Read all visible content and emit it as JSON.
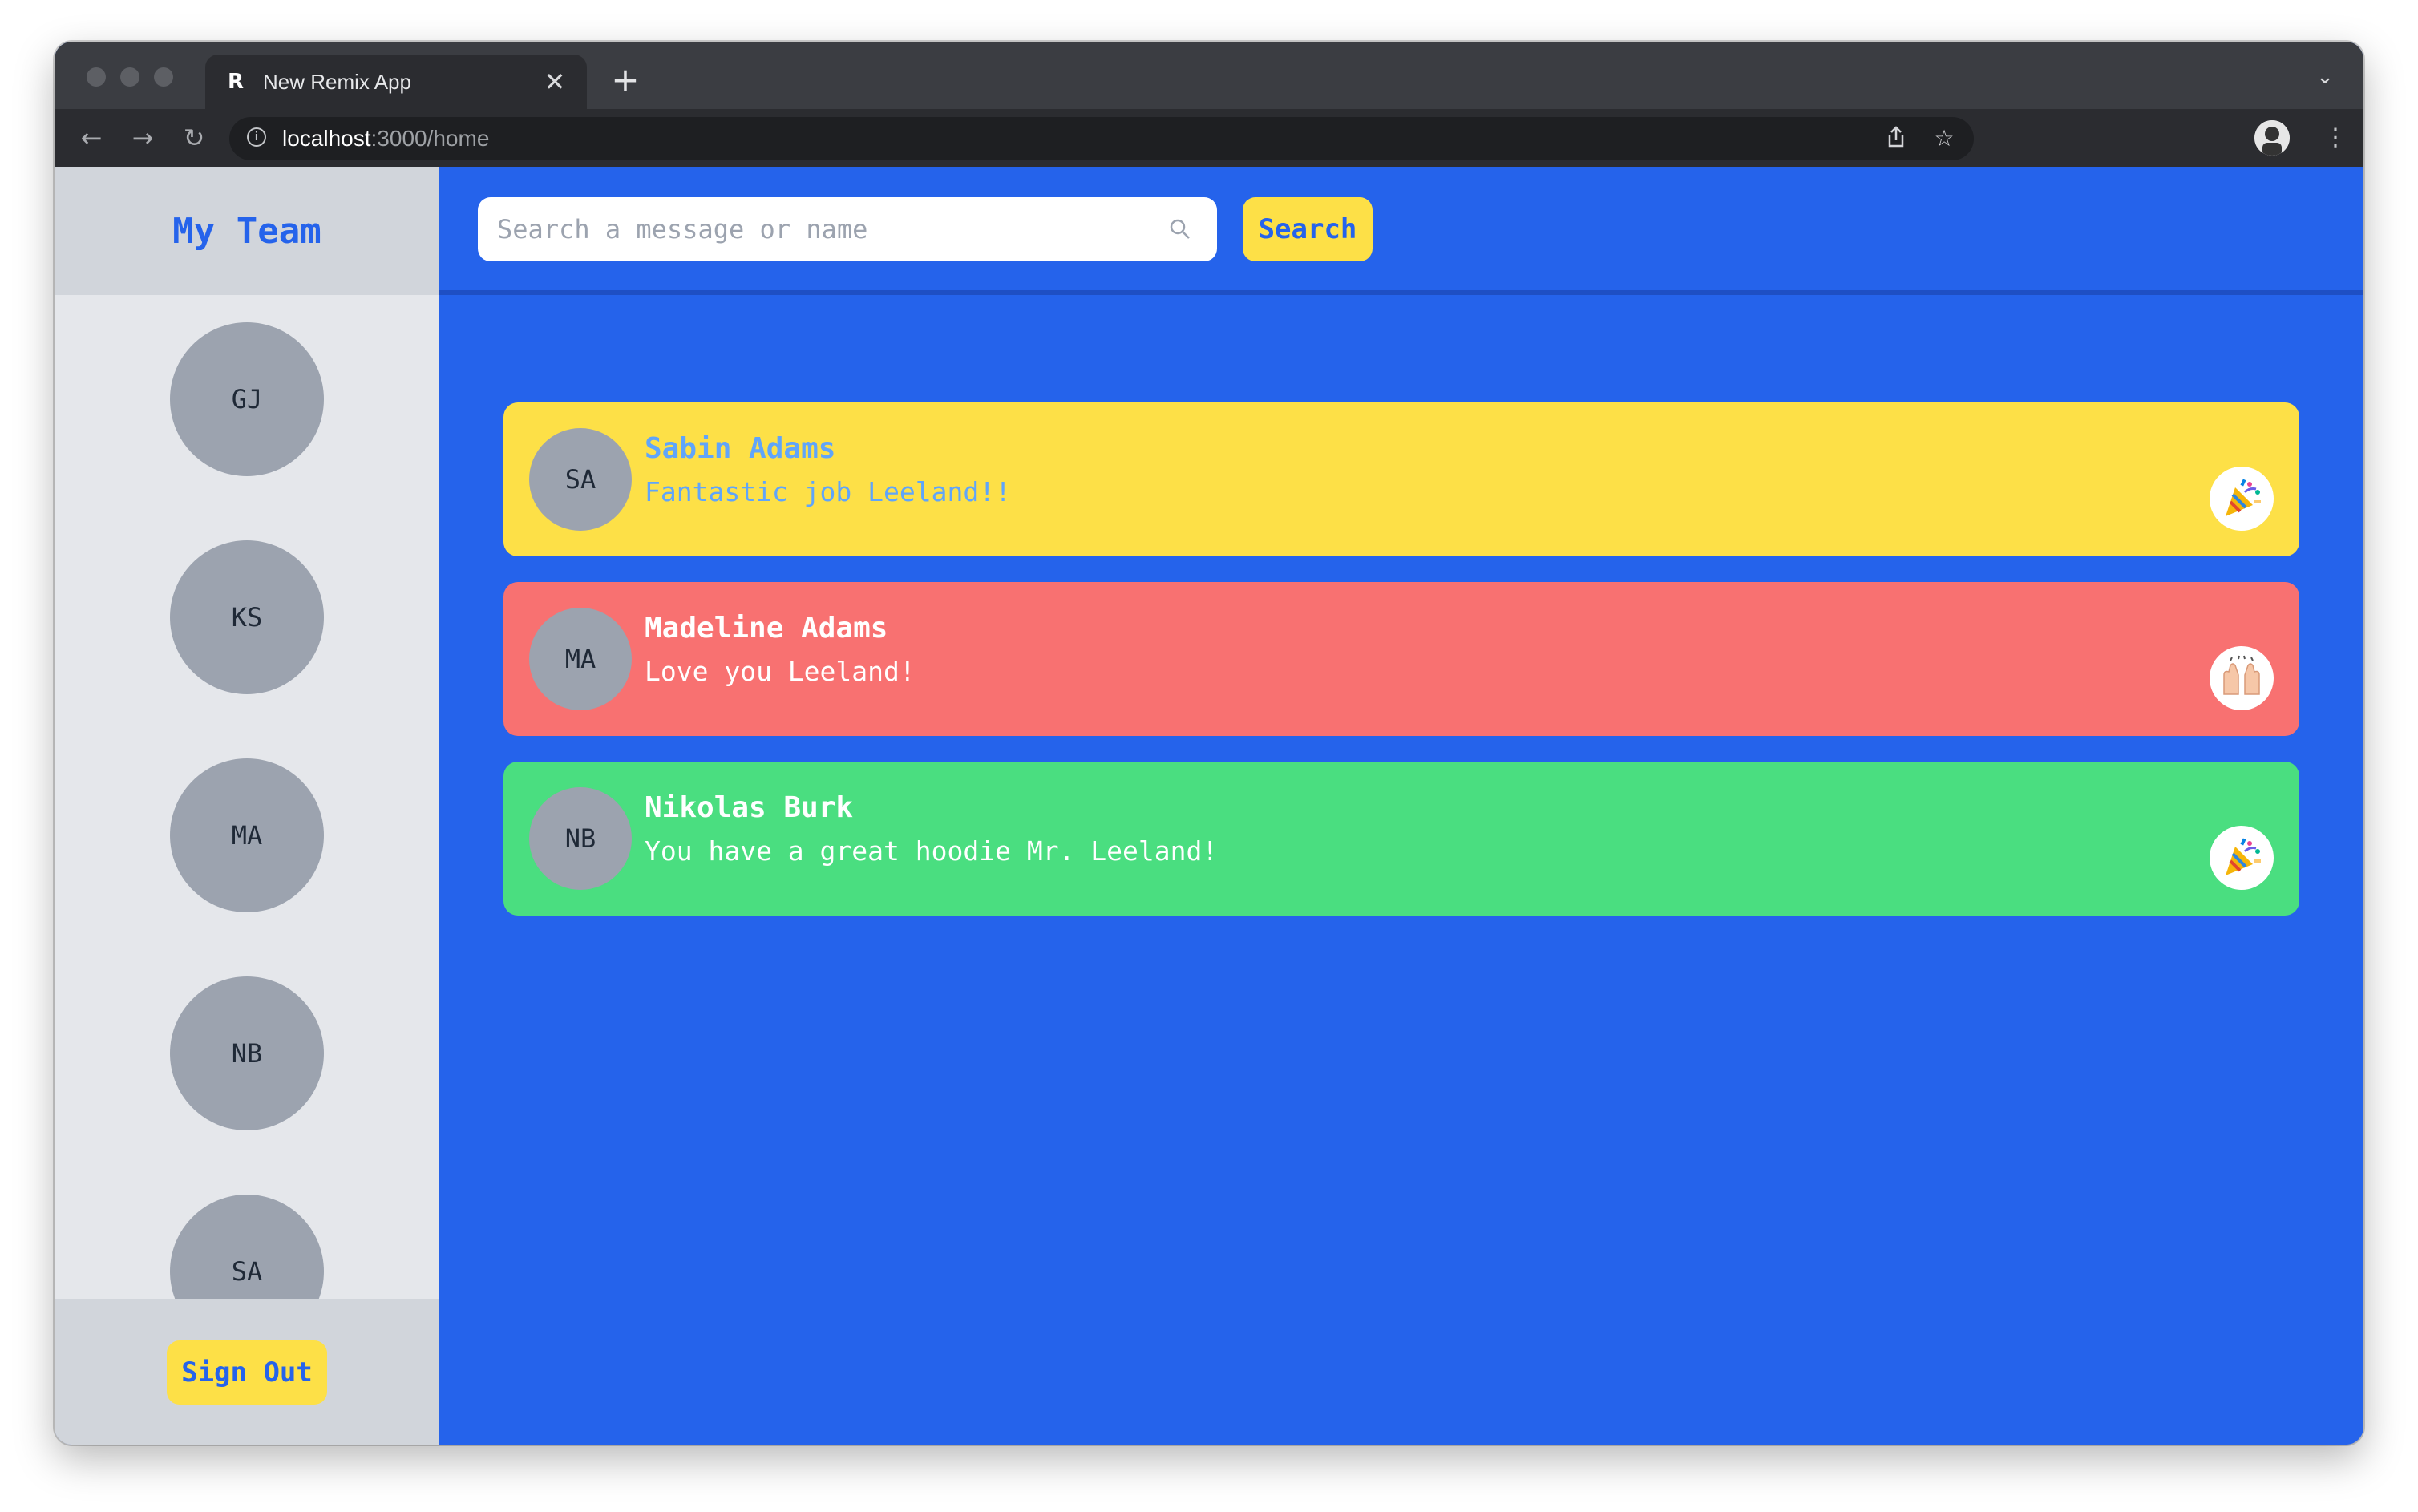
{
  "browser": {
    "tab_title": "New Remix App",
    "tab_favicon": "remix-logo-icon",
    "url_host": "localhost",
    "url_rest": ":3000/home"
  },
  "sidebar": {
    "title": "My Team",
    "members": [
      {
        "initials": "GJ"
      },
      {
        "initials": "KS"
      },
      {
        "initials": "MA"
      },
      {
        "initials": "NB"
      },
      {
        "initials": "SA"
      }
    ],
    "sign_out_label": "Sign Out"
  },
  "search": {
    "placeholder": "Search a message or name",
    "value": "",
    "button_label": "Search"
  },
  "kudos": [
    {
      "initials": "SA",
      "name": "Sabin Adams",
      "message": "Fantastic job Leeland!!",
      "emoji": "party-popper-icon",
      "background": "#fde047",
      "text_color": "#60a5fa"
    },
    {
      "initials": "MA",
      "name": "Madeline Adams",
      "message": "Love you Leeland!",
      "emoji": "raising-hands-icon",
      "background": "#f87171",
      "text_color": "#ffffff"
    },
    {
      "initials": "NB",
      "name": "Nikolas Burk",
      "message": "You have a great hoodie Mr. Leeland!",
      "emoji": "party-popper-icon",
      "background": "#4ade80",
      "text_color": "#ffffff"
    }
  ],
  "colors": {
    "accent": "#2563eb",
    "button_yellow": "#fde047",
    "avatar_gray": "#9ca3af",
    "sidebar_bg": "#e5e7eb",
    "sidebar_header_bg": "#d1d5db"
  }
}
